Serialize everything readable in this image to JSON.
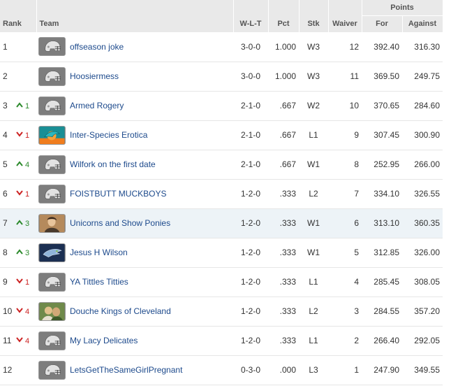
{
  "headers": {
    "points_group": "Points",
    "rank": "Rank",
    "team": "Team",
    "wlt": "W-L-T",
    "pct": "Pct",
    "stk": "Stk",
    "waiver": "Waiver",
    "for": "For",
    "against": "Against"
  },
  "colors": {
    "header_bg": "#e9e9e9",
    "link": "#1d4a8c",
    "up": "#2c8a2c",
    "down": "#cc2222",
    "highlight_row": "#edf3f7"
  },
  "rows": [
    {
      "rank": "1",
      "move_dir": "",
      "move_amt": "",
      "logo": "default-helmet-icon",
      "team": "offseason joke",
      "wlt": "3-0-0",
      "pct": "1.000",
      "stk": "W3",
      "waiver": "12",
      "for": "392.40",
      "against": "316.30"
    },
    {
      "rank": "2",
      "move_dir": "",
      "move_amt": "",
      "logo": "default-helmet-icon",
      "team": "Hoosiermess",
      "wlt": "3-0-0",
      "pct": "1.000",
      "stk": "W3",
      "waiver": "11",
      "for": "369.50",
      "against": "249.75"
    },
    {
      "rank": "3",
      "move_dir": "up",
      "move_amt": "1",
      "logo": "default-helmet-icon",
      "team": "Armed Rogery",
      "wlt": "2-1-0",
      "pct": ".667",
      "stk": "W2",
      "waiver": "10",
      "for": "370.65",
      "against": "284.60"
    },
    {
      "rank": "4",
      "move_dir": "down",
      "move_amt": "1",
      "logo": "dolphins-logo-icon",
      "team": "Inter-Species Erotica",
      "wlt": "2-1-0",
      "pct": ".667",
      "stk": "L1",
      "waiver": "9",
      "for": "307.45",
      "against": "300.90"
    },
    {
      "rank": "5",
      "move_dir": "up",
      "move_amt": "4",
      "logo": "default-helmet-icon",
      "team": "Wilfork on the first date",
      "wlt": "2-1-0",
      "pct": ".667",
      "stk": "W1",
      "waiver": "8",
      "for": "252.95",
      "against": "266.00"
    },
    {
      "rank": "6",
      "move_dir": "down",
      "move_amt": "1",
      "logo": "default-helmet-icon",
      "team": "FOISTBUTT MUCKBOYS",
      "wlt": "1-2-0",
      "pct": ".333",
      "stk": "L2",
      "waiver": "7",
      "for": "334.10",
      "against": "326.55"
    },
    {
      "rank": "7",
      "move_dir": "up",
      "move_amt": "3",
      "logo": "photo-avatar-icon",
      "team": "Unicorns and Show Ponies",
      "wlt": "1-2-0",
      "pct": ".333",
      "stk": "W1",
      "waiver": "6",
      "for": "313.10",
      "against": "360.35",
      "highlight": true
    },
    {
      "rank": "8",
      "move_dir": "up",
      "move_amt": "3",
      "logo": "seahawks-logo-icon",
      "team": "Jesus H Wilson",
      "wlt": "1-2-0",
      "pct": ".333",
      "stk": "W1",
      "waiver": "5",
      "for": "312.85",
      "against": "326.00"
    },
    {
      "rank": "9",
      "move_dir": "down",
      "move_amt": "1",
      "logo": "default-helmet-icon",
      "team": "YA Tittles Titties",
      "wlt": "1-2-0",
      "pct": ".333",
      "stk": "L1",
      "waiver": "4",
      "for": "285.45",
      "against": "308.05"
    },
    {
      "rank": "10",
      "move_dir": "down",
      "move_amt": "4",
      "logo": "photo-avatar-icon-2",
      "team": "Douche Kings of Cleveland",
      "wlt": "1-2-0",
      "pct": ".333",
      "stk": "L2",
      "waiver": "3",
      "for": "284.55",
      "against": "357.20"
    },
    {
      "rank": "11",
      "move_dir": "down",
      "move_amt": "4",
      "logo": "default-helmet-icon",
      "team": "My Lacy Delicates",
      "wlt": "1-2-0",
      "pct": ".333",
      "stk": "L1",
      "waiver": "2",
      "for": "266.40",
      "against": "292.05"
    },
    {
      "rank": "12",
      "move_dir": "",
      "move_amt": "",
      "logo": "default-helmet-icon",
      "team": "LetsGetTheSameGirlPregnant",
      "wlt": "0-3-0",
      "pct": ".000",
      "stk": "L3",
      "waiver": "1",
      "for": "247.90",
      "against": "349.55"
    }
  ]
}
